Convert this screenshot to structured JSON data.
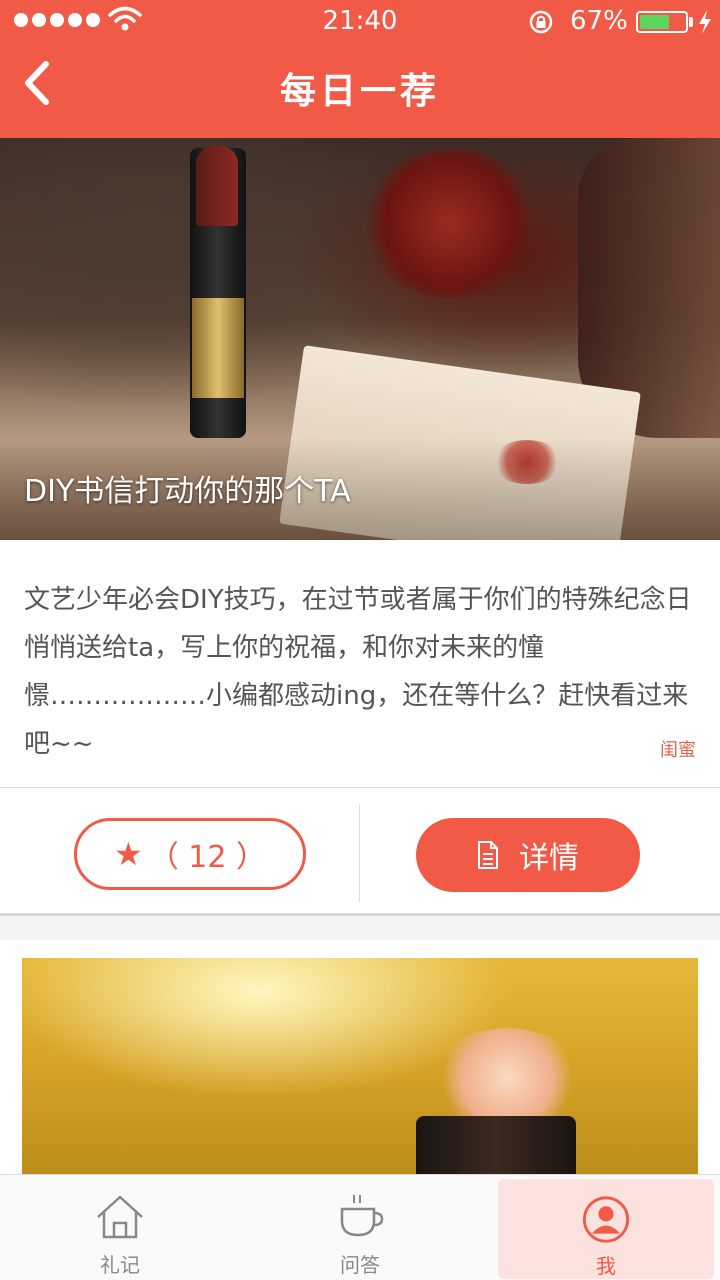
{
  "status_bar": {
    "time": "21:40",
    "battery_percent": "67%",
    "battery_level": 0.67
  },
  "header": {
    "title": "每日一荐",
    "back_icon": "chevron-left-icon"
  },
  "hero": {
    "caption": "DIY书信打动你的那个TA"
  },
  "article": {
    "description": "文艺少年必会DIY技巧，在过节或者属于你们的特殊纪念日悄悄送给ta，写上你的祝福，和你对未来的憧憬………………小编都感动ing，还在等什么？赶快看过来吧~~",
    "tag": "闺蜜"
  },
  "actions": {
    "favorite_label": "（ 12 ）",
    "favorite_star": "★",
    "detail_label": "详情"
  },
  "tabbar": {
    "items": [
      {
        "label": "礼记",
        "icon": "house-icon"
      },
      {
        "label": "问答",
        "icon": "cup-icon"
      },
      {
        "label": "我",
        "icon": "user-icon"
      }
    ],
    "active_index": 2
  },
  "colors": {
    "accent": "#f15a46",
    "active_tab_bg": "#fde1df"
  }
}
